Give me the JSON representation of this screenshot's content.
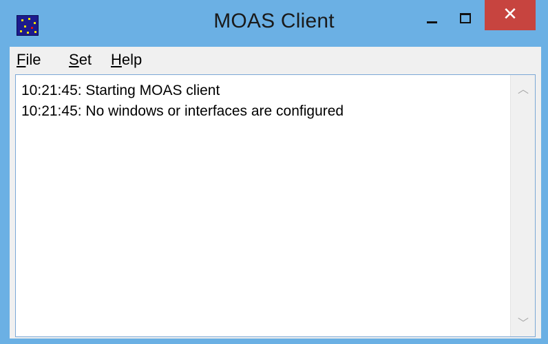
{
  "window": {
    "title": "MOAS Client",
    "close_glyph": "✕",
    "app_icon": "moas-app-icon"
  },
  "menu": {
    "items": [
      {
        "mnemonic": "F",
        "rest": "ile",
        "label": "File"
      },
      {
        "mnemonic": "S",
        "rest": "et",
        "label": "Set"
      },
      {
        "mnemonic": "H",
        "rest": "elp",
        "label": "Help"
      }
    ]
  },
  "log": {
    "lines": [
      "10:21:45: Starting MOAS client",
      "10:21:45: No windows or interfaces are configured"
    ]
  },
  "scrollbar": {
    "up_glyph": "︿",
    "down_glyph": "﹀"
  },
  "colors": {
    "title_bar": "#6bb0e4",
    "close_button": "#c7443f",
    "log_border": "#7aa7d6"
  }
}
